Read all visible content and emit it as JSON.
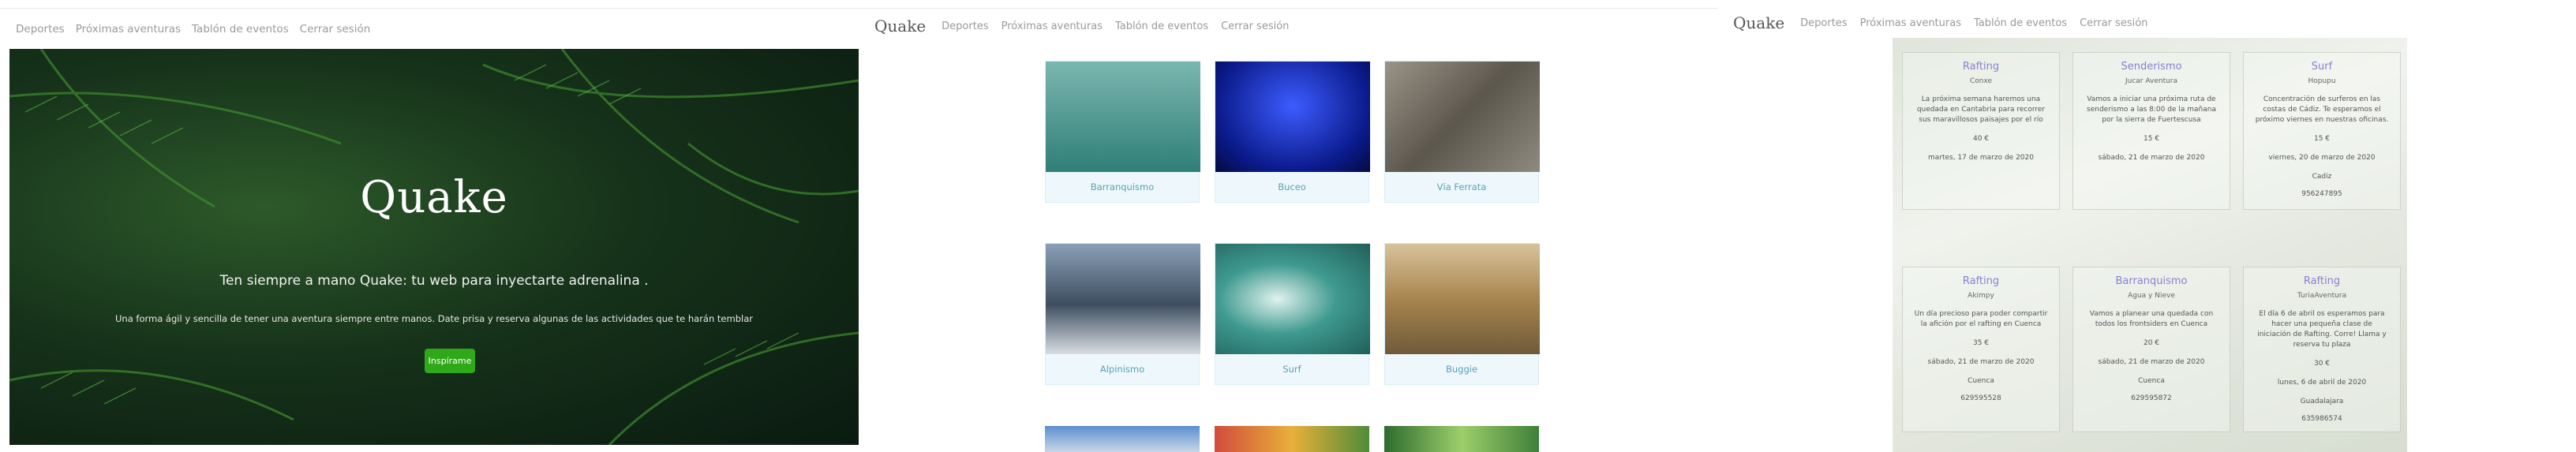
{
  "panel1": {
    "nav": [
      "Deportes",
      "Próximas aventuras",
      "Tablón de eventos",
      "Cerrar sesión"
    ],
    "hero": {
      "title": "Quake",
      "subtitle": "Ten siempre a mano Quake: tu web para inyectarte adrenalina .",
      "description": "Una forma ágil y sencilla de tener una aventura siempre entre manos. Date prisa y reserva algunas de las actividades que te harán temblar",
      "button": "Inspírame"
    }
  },
  "panel2": {
    "brand": "Quake",
    "nav": [
      "Deportes",
      "Próximas aventuras",
      "Tablón de eventos",
      "Cerrar sesión"
    ],
    "tiles": [
      {
        "label": "Barranquismo",
        "color": "#3e8f86"
      },
      {
        "label": "Buceo",
        "color": "#1d2fb8"
      },
      {
        "label": "Vía Ferrata",
        "color": "#6f6a5f"
      },
      {
        "label": "Alpinismo",
        "color": "#5d6f86"
      },
      {
        "label": "Surf",
        "color": "#2e7e76"
      },
      {
        "label": "Buggie",
        "color": "#b69a60"
      }
    ]
  },
  "panel3": {
    "brand": "Quake",
    "nav": [
      "Deportes",
      "Próximas aventuras",
      "Tablón de eventos",
      "Cerrar sesión"
    ],
    "cards": [
      {
        "title": "Rafting",
        "org": "Conxe",
        "desc": "La próxima semana haremos una quedada en Cantabria para recorrer sus maravillosos paisajes por el río",
        "price": "40 €",
        "date": "martes, 17 de marzo de 2020",
        "city": "",
        "phone": ""
      },
      {
        "title": "Senderismo",
        "org": "Jucar Aventura",
        "desc": "Vamos a iniciar una próxima ruta de senderismo a las 8:00 de la mañana por la sierra de Fuertescusa",
        "price": "15 €",
        "date": "sábado, 21 de marzo de 2020",
        "city": "",
        "phone": ""
      },
      {
        "title": "Surf",
        "org": "Hopupu",
        "desc": "Concentración de surferos en las costas de Cádiz. Te esperamos el próximo viernes en nuestras oficinas.",
        "price": "15 €",
        "date": "viernes, 20 de marzo de 2020",
        "city": "Cadiz",
        "phone": "956247895"
      },
      {
        "title": "Rafting",
        "org": "Akimpy",
        "desc": "Un día precioso para poder compartir la afición por el rafting en Cuenca",
        "price": "35 €",
        "date": "sábado, 21 de marzo de 2020",
        "city": "Cuenca",
        "phone": "629595528"
      },
      {
        "title": "Barranquismo",
        "org": "Agua y Nieve",
        "desc": "Vamos a planear una quedada con todos los frontsiders en Cuenca",
        "price": "20 €",
        "date": "sábado, 21 de marzo de 2020",
        "city": "Cuenca",
        "phone": "629595872"
      },
      {
        "title": "Rafting",
        "org": "TuriaAventura",
        "desc": "El día 6 de abril os esperamos para hacer una pequeña clase de iniciación de Rafting. Corre! Llama y reserva tu plaza",
        "price": "30 €",
        "date": "lunes, 6 de abril de 2020",
        "city": "Guadalajara",
        "phone": "635986574"
      }
    ]
  }
}
